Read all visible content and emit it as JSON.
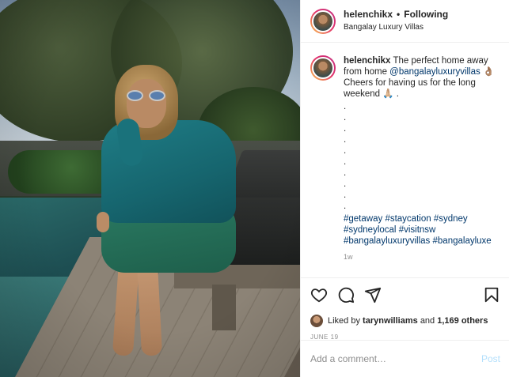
{
  "header": {
    "username": "helenchikx",
    "separator": "•",
    "follow_status": "Following",
    "location": "Bangalay Luxury Villas"
  },
  "caption": {
    "username": "helenchikx",
    "text_part1": "The perfect home away from home",
    "mention": "@bangalayluxuryvillas",
    "emoji1": "👌🏽",
    "text_part2": "Cheers for having us for the long weekend",
    "emoji2": "🙏🏼",
    "text_end": ".",
    "dots": [
      ".",
      ".",
      ".",
      ".",
      ".",
      ".",
      ".",
      ".",
      ".",
      "."
    ],
    "hashtags": [
      "#getaway",
      "#staycation",
      "#sydney",
      "#sydneylocal",
      "#visitnsw",
      "#bangalayluxuryvillas",
      "#bangalayluxe"
    ],
    "time_ago": "1w"
  },
  "engagement": {
    "liked_by_prefix": "Liked by",
    "liked_by_user": "tarynwilliams",
    "liked_by_and": "and",
    "others": "1,169 others",
    "date": "JUNE 19"
  },
  "comment_box": {
    "placeholder": "Add a comment…",
    "post_label": "Post"
  },
  "icons": {
    "like": "heart-icon",
    "comment": "comment-icon",
    "share": "share-icon",
    "save": "bookmark-icon"
  },
  "colors": {
    "link": "#00376b",
    "post_button_disabled": "#b2dffc",
    "muted": "#8e8e8e"
  }
}
